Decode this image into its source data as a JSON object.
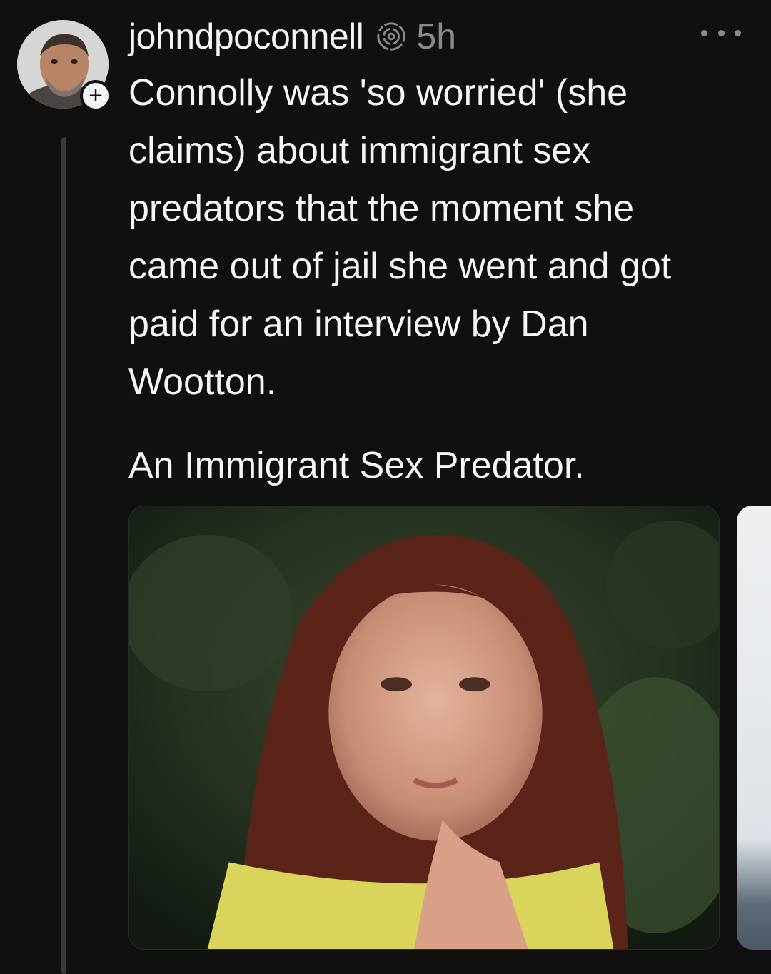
{
  "post": {
    "username": "johndpoconnell",
    "time": "5h",
    "body": "Connolly was 'so worried' (she\nclaims) about immigrant sex\npredators that the moment she\ncame out of jail she went and got\npaid for an interview by Dan\nWootton.",
    "second_paragraph": "An Immigrant Sex Predator.",
    "follow_symbol": "+",
    "icons": {
      "author_badge": "threads-swirl-icon",
      "more": "more-horizontal-icon",
      "follow": "plus-icon"
    },
    "media_count_visible": 2
  },
  "colors": {
    "background": "#101010",
    "text": "#f3f5f7",
    "muted": "#8a8a8a",
    "thread_line": "#3a3a3a"
  }
}
